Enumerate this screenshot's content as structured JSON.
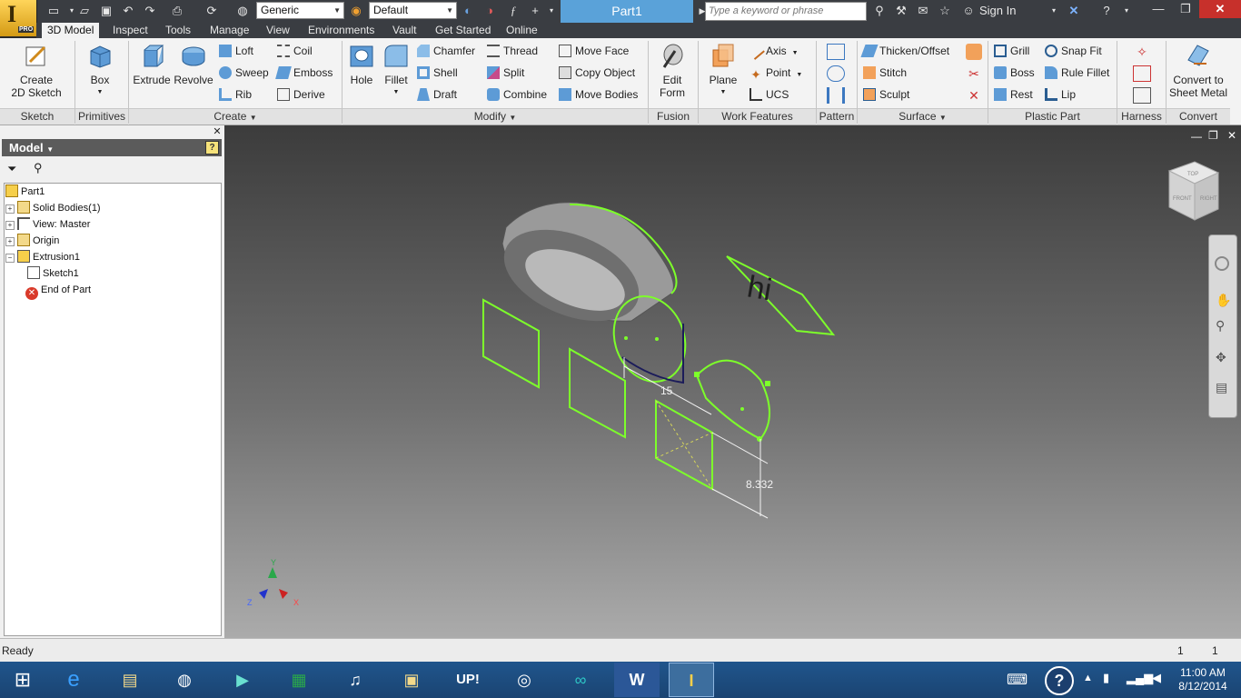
{
  "titlebar": {
    "appearance_combo": "Generic",
    "material_combo": "Default",
    "doc_title": "Part1",
    "search_placeholder": "Type a keyword or phrase",
    "sign_in": "Sign In",
    "app_pro_badge": "PRO"
  },
  "tabs": [
    "3D Model",
    "Inspect",
    "Tools",
    "Manage",
    "View",
    "Environments",
    "Vault",
    "Get Started",
    "Online"
  ],
  "ribbon": {
    "groups": {
      "sketch": "Sketch",
      "primitives": "Primitives",
      "create": "Create",
      "modify": "Modify",
      "fusion": "Fusion",
      "work_features": "Work Features",
      "pattern": "Pattern",
      "surface": "Surface",
      "plastic_part": "Plastic Part",
      "harness": "Harness",
      "convert": "Convert"
    },
    "create_sketch": "Create\n2D Sketch",
    "box": "Box",
    "extrude": "Extrude",
    "revolve": "Revolve",
    "loft": "Loft",
    "coil": "Coil",
    "sweep": "Sweep",
    "emboss": "Emboss",
    "rib": "Rib",
    "derive": "Derive",
    "hole": "Hole",
    "fillet": "Fillet",
    "chamfer": "Chamfer",
    "thread": "Thread",
    "move_face": "Move Face",
    "shell": "Shell",
    "split": "Split",
    "copy_object": "Copy Object",
    "draft": "Draft",
    "combine": "Combine",
    "move_bodies": "Move Bodies",
    "edit_form": "Edit\nForm",
    "plane": "Plane",
    "axis": "Axis",
    "point": "Point",
    "ucs": "UCS",
    "thicken_offset": "Thicken/Offset",
    "stitch": "Stitch",
    "sculpt": "Sculpt",
    "grill": "Grill",
    "snap_fit": "Snap Fit",
    "boss": "Boss",
    "rule_fillet": "Rule Fillet",
    "rest": "Rest",
    "lip": "Lip",
    "convert_sheet_metal": "Convert to\nSheet Metal"
  },
  "browser": {
    "header": "Model",
    "tree": [
      {
        "label": "Part1"
      },
      {
        "label": "Solid Bodies(1)"
      },
      {
        "label": "View: Master"
      },
      {
        "label": "Origin"
      },
      {
        "label": "Extrusion1"
      },
      {
        "label": "Sketch1"
      },
      {
        "label": "End of Part"
      }
    ]
  },
  "viewport": {
    "sketch_text": "hi",
    "dimension_1": "15",
    "dimension_2": "8.332",
    "viewcube_faces": [
      "TOP",
      "FRONT",
      "RIGHT"
    ],
    "triad": {
      "x": "X",
      "y": "Y",
      "z": "Z"
    }
  },
  "status": {
    "text": "Ready",
    "count1": "1",
    "count2": "1"
  },
  "taskbar": {
    "time": "11:00 AM",
    "date": "8/12/2014",
    "apps": [
      "internet-explorer",
      "file-explorer",
      "hp",
      "video",
      "store",
      "itunes",
      "photos",
      "up",
      "steam",
      "arduino",
      "word",
      "inventor"
    ]
  },
  "colors": {
    "sketch_green": "#7dff2a",
    "title_accent": "#5aa2d9",
    "close_red": "#c7302b"
  }
}
